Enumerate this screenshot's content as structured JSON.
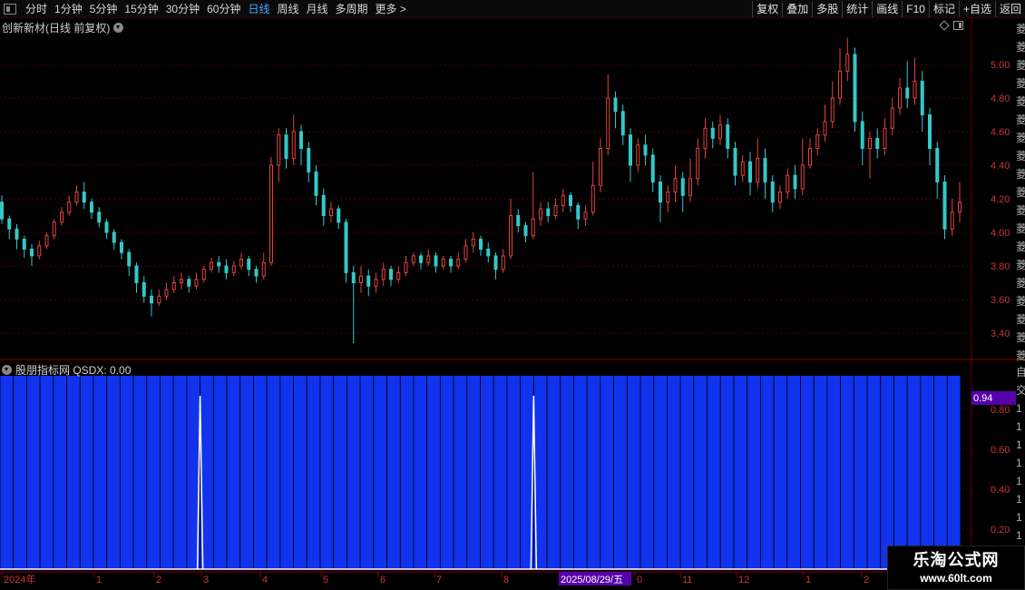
{
  "toolbar": {
    "periods": [
      "分时",
      "1分钟",
      "5分钟",
      "15分钟",
      "30分钟",
      "60分钟",
      "日线",
      "周线",
      "月线",
      "多周期",
      "更多 >"
    ],
    "active_period": "日线",
    "actions": [
      "复权",
      "叠加",
      "多股",
      "统计",
      "画线",
      "F10",
      "标记",
      "+自选",
      "返回"
    ]
  },
  "chart_title": "创新新材(日线 前复权)",
  "indicator_title": "股朋指标网 QSDX: 0.00",
  "side_chars_top": "菱菱菱菱菱菱菱菱菱菱菱菱菱菱菱菱菱菱菱",
  "side_chars_bottom": "自交111111111",
  "colors": {
    "up": "#e2443e",
    "down": "#35c8c8",
    "bar_fill": "#1133ee",
    "bar_edge": "#000000",
    "axis_text": "#cc3333",
    "highlight_bg": "#5500aa",
    "spike": "#ffffff"
  },
  "watermark": {
    "name": "乐淘公式网",
    "url": "www.60lt.com"
  },
  "chart_data": [
    {
      "type": "candlestick",
      "yticks": [
        5.0,
        4.8,
        4.6,
        4.4,
        4.2,
        4.0,
        3.8,
        3.6,
        3.4
      ],
      "ylim": [
        3.3,
        5.2
      ],
      "candles": [
        [
          4.18,
          4.08,
          4.22,
          4.05
        ],
        [
          4.08,
          4.02,
          4.1,
          3.96
        ],
        [
          4.02,
          3.96,
          4.05,
          3.9
        ],
        [
          3.96,
          3.9,
          3.98,
          3.85
        ],
        [
          3.9,
          3.86,
          3.93,
          3.8
        ],
        [
          3.86,
          3.92,
          3.95,
          3.84
        ],
        [
          3.92,
          3.98,
          4.0,
          3.9
        ],
        [
          3.98,
          4.06,
          4.08,
          3.96
        ],
        [
          4.06,
          4.12,
          4.15,
          4.04
        ],
        [
          4.12,
          4.18,
          4.22,
          4.1
        ],
        [
          4.18,
          4.24,
          4.28,
          4.16
        ],
        [
          4.24,
          4.18,
          4.3,
          4.14
        ],
        [
          4.18,
          4.12,
          4.2,
          4.08
        ],
        [
          4.12,
          4.06,
          4.15,
          4.03
        ],
        [
          4.06,
          4.0,
          4.08,
          3.96
        ],
        [
          4.0,
          3.94,
          4.02,
          3.9
        ],
        [
          3.94,
          3.88,
          3.96,
          3.84
        ],
        [
          3.88,
          3.8,
          3.9,
          3.74
        ],
        [
          3.8,
          3.7,
          3.82,
          3.64
        ],
        [
          3.7,
          3.62,
          3.74,
          3.58
        ],
        [
          3.62,
          3.58,
          3.66,
          3.5
        ],
        [
          3.58,
          3.62,
          3.66,
          3.56
        ],
        [
          3.62,
          3.66,
          3.7,
          3.6
        ],
        [
          3.66,
          3.7,
          3.74,
          3.64
        ],
        [
          3.7,
          3.72,
          3.76,
          3.66
        ],
        [
          3.72,
          3.68,
          3.74,
          3.64
        ],
        [
          3.68,
          3.72,
          3.76,
          3.66
        ],
        [
          3.72,
          3.78,
          3.8,
          3.7
        ],
        [
          3.78,
          3.82,
          3.85,
          3.76
        ],
        [
          3.82,
          3.8,
          3.86,
          3.76
        ],
        [
          3.8,
          3.76,
          3.84,
          3.72
        ],
        [
          3.76,
          3.8,
          3.83,
          3.74
        ],
        [
          3.8,
          3.84,
          3.88,
          3.78
        ],
        [
          3.84,
          3.78,
          3.86,
          3.74
        ],
        [
          3.78,
          3.74,
          3.8,
          3.7
        ],
        [
          3.74,
          3.82,
          3.88,
          3.72
        ],
        [
          3.82,
          4.4,
          4.45,
          3.8
        ],
        [
          4.4,
          4.58,
          4.62,
          4.3
        ],
        [
          4.58,
          4.44,
          4.62,
          4.38
        ],
        [
          4.44,
          4.6,
          4.7,
          4.4
        ],
        [
          4.6,
          4.5,
          4.64,
          4.4
        ],
        [
          4.5,
          4.36,
          4.54,
          4.3
        ],
        [
          4.36,
          4.22,
          4.4,
          4.16
        ],
        [
          4.22,
          4.1,
          4.26,
          4.04
        ],
        [
          4.1,
          4.14,
          4.18,
          4.06
        ],
        [
          4.14,
          4.06,
          4.16,
          4.02
        ],
        [
          4.06,
          3.76,
          4.08,
          3.7
        ],
        [
          3.76,
          3.7,
          3.8,
          3.34
        ],
        [
          3.7,
          3.74,
          3.8,
          3.64
        ],
        [
          3.74,
          3.68,
          3.78,
          3.62
        ],
        [
          3.68,
          3.72,
          3.76,
          3.64
        ],
        [
          3.72,
          3.78,
          3.82,
          3.68
        ],
        [
          3.78,
          3.72,
          3.8,
          3.68
        ],
        [
          3.72,
          3.76,
          3.8,
          3.7
        ],
        [
          3.76,
          3.82,
          3.86,
          3.74
        ],
        [
          3.82,
          3.86,
          3.88,
          3.8
        ],
        [
          3.86,
          3.82,
          3.88,
          3.78
        ],
        [
          3.82,
          3.86,
          3.9,
          3.8
        ],
        [
          3.86,
          3.8,
          3.88,
          3.76
        ],
        [
          3.8,
          3.84,
          3.86,
          3.78
        ],
        [
          3.84,
          3.8,
          3.86,
          3.76
        ],
        [
          3.8,
          3.84,
          3.88,
          3.78
        ],
        [
          3.84,
          3.92,
          3.96,
          3.82
        ],
        [
          3.92,
          3.96,
          4.0,
          3.88
        ],
        [
          3.96,
          3.9,
          3.98,
          3.86
        ],
        [
          3.9,
          3.86,
          3.94,
          3.82
        ],
        [
          3.86,
          3.78,
          3.88,
          3.72
        ],
        [
          3.78,
          3.86,
          3.9,
          3.76
        ],
        [
          3.86,
          4.1,
          4.2,
          3.84
        ],
        [
          4.1,
          4.04,
          4.14,
          4.0
        ],
        [
          4.04,
          3.98,
          4.06,
          3.94
        ],
        [
          3.98,
          4.08,
          4.36,
          3.96
        ],
        [
          4.08,
          4.14,
          4.18,
          4.04
        ],
        [
          4.14,
          4.1,
          4.18,
          4.06
        ],
        [
          4.1,
          4.16,
          4.2,
          4.08
        ],
        [
          4.16,
          4.22,
          4.26,
          4.12
        ],
        [
          4.22,
          4.16,
          4.24,
          4.12
        ],
        [
          4.16,
          4.08,
          4.18,
          4.02
        ],
        [
          4.08,
          4.12,
          4.16,
          4.04
        ],
        [
          4.12,
          4.28,
          4.42,
          4.1
        ],
        [
          4.28,
          4.5,
          4.56,
          4.24
        ],
        [
          4.5,
          4.8,
          4.94,
          4.46
        ],
        [
          4.8,
          4.72,
          4.84,
          4.62
        ],
        [
          4.72,
          4.58,
          4.76,
          4.52
        ],
        [
          4.58,
          4.4,
          4.62,
          4.3
        ],
        [
          4.4,
          4.52,
          4.56,
          4.36
        ],
        [
          4.52,
          4.46,
          4.58,
          4.4
        ],
        [
          4.46,
          4.3,
          4.5,
          4.24
        ],
        [
          4.3,
          4.18,
          4.34,
          4.06
        ],
        [
          4.18,
          4.24,
          4.28,
          4.12
        ],
        [
          4.24,
          4.32,
          4.4,
          4.18
        ],
        [
          4.32,
          4.22,
          4.36,
          4.12
        ],
        [
          4.22,
          4.32,
          4.44,
          4.18
        ],
        [
          4.32,
          4.5,
          4.56,
          4.28
        ],
        [
          4.5,
          4.62,
          4.68,
          4.44
        ],
        [
          4.62,
          4.56,
          4.66,
          4.5
        ],
        [
          4.56,
          4.64,
          4.7,
          4.52
        ],
        [
          4.64,
          4.5,
          4.68,
          4.44
        ],
        [
          4.5,
          4.34,
          4.54,
          4.28
        ],
        [
          4.34,
          4.42,
          4.46,
          4.3
        ],
        [
          4.42,
          4.3,
          4.48,
          4.22
        ],
        [
          4.3,
          4.44,
          4.56,
          4.26
        ],
        [
          4.44,
          4.3,
          4.5,
          4.2
        ],
        [
          4.3,
          4.18,
          4.34,
          4.12
        ],
        [
          4.18,
          4.24,
          4.28,
          4.14
        ],
        [
          4.24,
          4.34,
          4.38,
          4.2
        ],
        [
          4.34,
          4.26,
          4.4,
          4.2
        ],
        [
          4.26,
          4.4,
          4.56,
          4.22
        ],
        [
          4.4,
          4.5,
          4.56,
          4.38
        ],
        [
          4.5,
          4.58,
          4.62,
          4.46
        ],
        [
          4.58,
          4.66,
          4.76,
          4.54
        ],
        [
          4.66,
          4.8,
          4.9,
          4.62
        ],
        [
          4.8,
          4.96,
          5.1,
          4.76
        ],
        [
          4.96,
          5.06,
          5.16,
          4.9
        ],
        [
          5.06,
          4.66,
          5.1,
          4.6
        ],
        [
          4.66,
          4.5,
          4.72,
          4.4
        ],
        [
          4.5,
          4.56,
          4.6,
          4.32
        ],
        [
          4.56,
          4.5,
          4.62,
          4.44
        ],
        [
          4.5,
          4.62,
          4.68,
          4.46
        ],
        [
          4.62,
          4.74,
          4.8,
          4.58
        ],
        [
          4.74,
          4.86,
          4.92,
          4.7
        ],
        [
          4.86,
          4.8,
          5.02,
          4.74
        ],
        [
          4.8,
          4.9,
          5.04,
          4.76
        ],
        [
          4.9,
          4.7,
          4.96,
          4.6
        ],
        [
          4.7,
          4.5,
          4.74,
          4.4
        ],
        [
          4.5,
          4.3,
          4.54,
          4.2
        ],
        [
          4.3,
          4.02,
          4.34,
          3.96
        ],
        [
          4.02,
          4.12,
          4.2,
          3.98
        ],
        [
          4.12,
          4.18,
          4.3,
          4.06
        ]
      ],
      "xlabels": [
        "2024年",
        "1",
        "2",
        "3",
        "4",
        "5",
        "6",
        "7",
        "8",
        "2025/08/29/五",
        "0",
        "11",
        "12",
        "1",
        "2"
      ],
      "highlight_label": "2025/08/29/五"
    },
    {
      "type": "bar",
      "yticks": [
        0.8,
        0.6,
        0.4,
        0.2
      ],
      "ylim": [
        0.0,
        1.0
      ],
      "current_label": "0.94",
      "bars": 72,
      "spike_positions": [
        15,
        40
      ],
      "value": 0.97
    }
  ]
}
